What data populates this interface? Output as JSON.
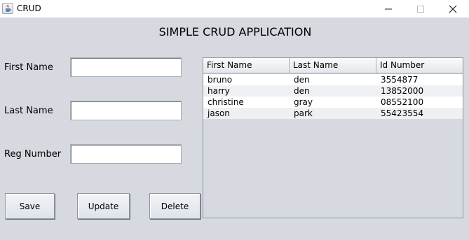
{
  "window": {
    "title": "CRUD",
    "controls": [
      "minimize-icon",
      "maximize-icon",
      "close-icon"
    ]
  },
  "heading": "SIMPLE CRUD APPLICATION",
  "form": {
    "first_name": {
      "label": "First Name",
      "value": ""
    },
    "last_name": {
      "label": "Last Name",
      "value": ""
    },
    "reg_number": {
      "label": "Reg Number",
      "value": ""
    }
  },
  "buttons": {
    "save": "Save",
    "update": "Update",
    "delete": "Delete"
  },
  "table": {
    "columns": [
      "First Name",
      "Last Name",
      "Id Number"
    ],
    "rows": [
      [
        "bruno",
        "den",
        "3554877"
      ],
      [
        "harry",
        "den",
        "13852000"
      ],
      [
        "christine",
        "gray",
        "08552100"
      ],
      [
        "jason",
        "park",
        "55423554"
      ]
    ]
  }
}
